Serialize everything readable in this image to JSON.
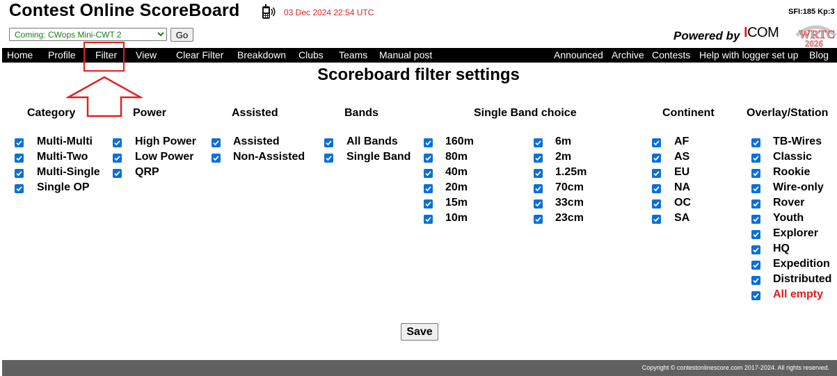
{
  "header": {
    "title": "Contest Online ScoreBoard",
    "datetime": "03 Dec 2024 22:54 UTC",
    "sfi": "SFI:185 Kp:3",
    "contest_selected": "Coming: CWops Mini-CWT 2",
    "go_label": "Go",
    "powered_by": "Powered by",
    "brand": "ICOM",
    "brand_color": "#e0201e"
  },
  "nav": {
    "left": [
      "Home",
      "Profile",
      "Filter",
      "View",
      "Clear Filter",
      "Breakdown",
      "Clubs",
      "Teams",
      "Manual post"
    ],
    "right": [
      "Announced",
      "Archive",
      "Contests",
      "Help with logger set up",
      "Blog"
    ]
  },
  "page_title": "Scoreboard filter settings",
  "columns": {
    "category": {
      "heading": "Category",
      "options": [
        "Multi-Multi",
        "Multi-Two",
        "Multi-Single",
        "Single OP"
      ]
    },
    "power": {
      "heading": "Power",
      "options": [
        "High Power",
        "Low Power",
        "QRP"
      ]
    },
    "assisted": {
      "heading": "Assisted",
      "options": [
        "Assisted",
        "Non-Assisted"
      ]
    },
    "bands": {
      "heading": "Bands",
      "options": [
        "All Bands",
        "Single Band"
      ]
    },
    "single_band": {
      "heading": "Single Band choice",
      "left": [
        "160m",
        "80m",
        "40m",
        "20m",
        "15m",
        "10m"
      ],
      "right": [
        "6m",
        "2m",
        "1.25m",
        "70cm",
        "33cm",
        "23cm"
      ]
    },
    "continent": {
      "heading": "Continent",
      "options": [
        "AF",
        "AS",
        "EU",
        "NA",
        "OC",
        "SA"
      ]
    },
    "overlay": {
      "heading": "Overlay/Station",
      "options": [
        "TB-Wires",
        "Classic",
        "Rookie",
        "Wire-only",
        "Rover",
        "Youth",
        "Explorer",
        "HQ",
        "Expedition",
        "Distributed",
        "All empty"
      ]
    }
  },
  "save_label": "Save",
  "footer": {
    "copyright": "Copyright © contestonlinescore.com 2017-2024. All rights reserved."
  },
  "colors": {
    "checkbox": "#0b6fdb",
    "highlight": "#e0201e",
    "alert_text": "#e61919"
  }
}
